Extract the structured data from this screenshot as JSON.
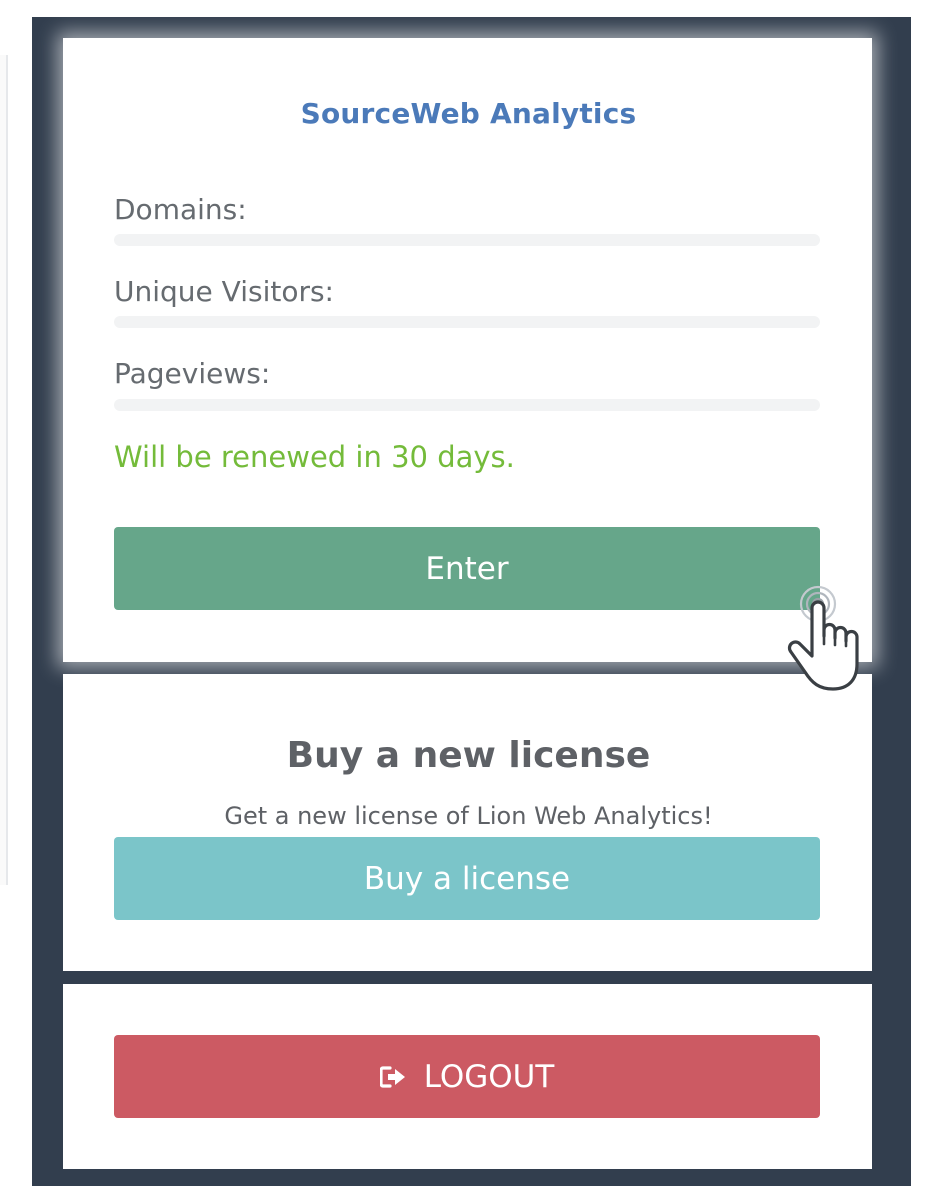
{
  "app": {
    "title": "SourceWeb Analytics"
  },
  "stats": [
    {
      "label": "Domains:",
      "progress": 0
    },
    {
      "label": "Unique Visitors:",
      "progress": 0
    },
    {
      "label": "Pageviews:",
      "progress": 0
    }
  ],
  "renewal": {
    "text": "Will be renewed in 30 days."
  },
  "buttons": {
    "enter_label": "Enter",
    "buy_label": "Buy a license",
    "logout_label": "LOGOUT"
  },
  "license": {
    "heading": "Buy a new license",
    "subtext": "Get a new license of Lion Web Analytics!"
  },
  "icons": {
    "logout": "sign-out-icon",
    "cursor": "hand-pointer-icon"
  },
  "colors": {
    "frame": "#323e4e",
    "title": "#4b7ab9",
    "renewal": "#74bb3a",
    "enter": "#66a68a",
    "buy": "#7bc5c9",
    "logout": "#cc5a63"
  }
}
